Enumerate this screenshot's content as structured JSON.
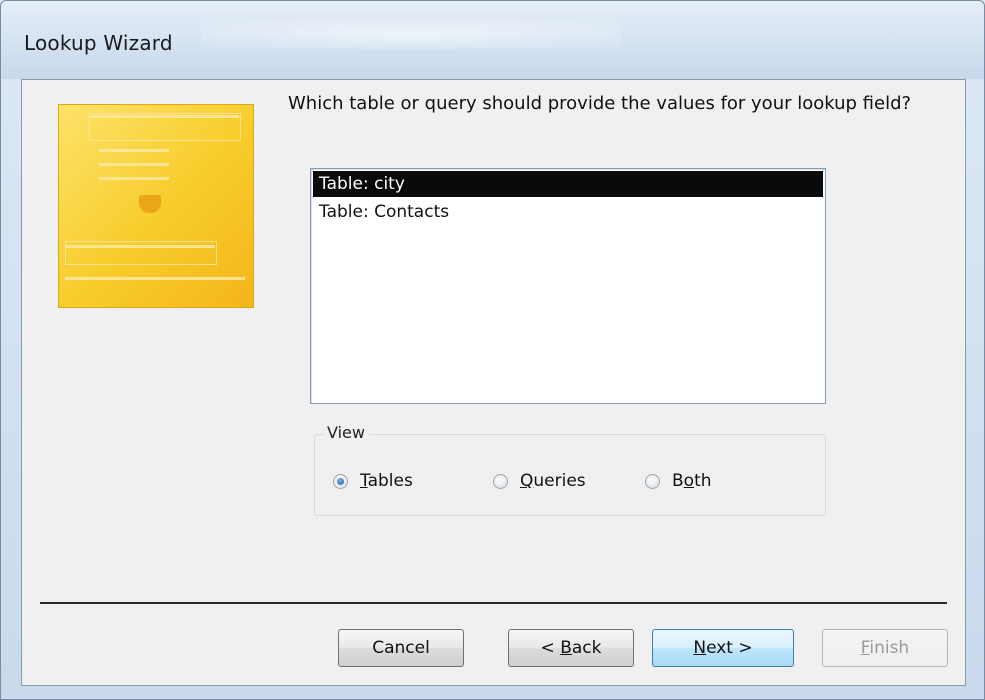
{
  "window": {
    "title": "Lookup Wizard"
  },
  "prompt": "Which table or query should provide the values for your lookup field?",
  "listbox": {
    "items": [
      "Table: city",
      "Table: Contacts"
    ],
    "selected_index": 0
  },
  "view_group": {
    "legend": "View",
    "options": [
      {
        "pre": "",
        "mnemonic": "T",
        "post": "ables",
        "checked": true
      },
      {
        "pre": "",
        "mnemonic": "Q",
        "post": "ueries",
        "checked": false
      },
      {
        "pre": "B",
        "mnemonic": "o",
        "post": "th",
        "checked": false
      }
    ]
  },
  "buttons": {
    "cancel": {
      "pre": "Cancel",
      "mnemonic": "",
      "post": ""
    },
    "back": {
      "pre": "< ",
      "mnemonic": "B",
      "post": "ack"
    },
    "next": {
      "pre": "",
      "mnemonic": "N",
      "post": "ext >"
    },
    "finish": {
      "pre": "",
      "mnemonic": "F",
      "post": "inish",
      "disabled": true
    }
  },
  "colors": {
    "selection": "#0a0a0a",
    "radio_checked": "#1f5fa8",
    "focus_button": "#bee6fd",
    "wizard_art": "#f7cc2a"
  },
  "icons": {
    "wizard_art": "wizard-illustration-icon"
  }
}
